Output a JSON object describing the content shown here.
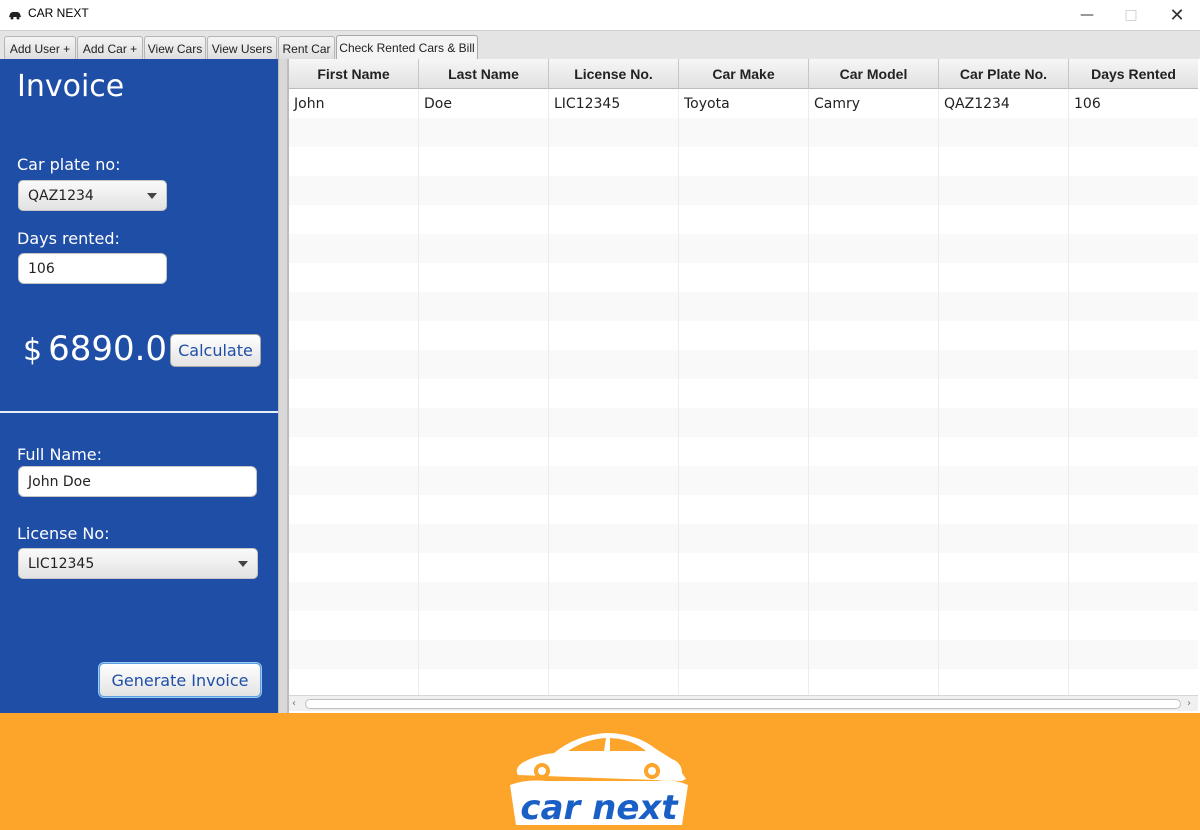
{
  "window": {
    "title": "CAR NEXT"
  },
  "tabs": [
    {
      "label": "Add User +"
    },
    {
      "label": "Add Car +"
    },
    {
      "label": "View Cars"
    },
    {
      "label": "View Users"
    },
    {
      "label": "Rent Car"
    },
    {
      "label": "Check Rented Cars & Bill",
      "active": true
    }
  ],
  "invoice": {
    "title": "Invoice",
    "car_plate_label": "Car plate no:",
    "car_plate_value": "QAZ1234",
    "days_rented_label": "Days rented:",
    "days_rented_value": "106",
    "currency": "$",
    "amount": "6890.0",
    "calculate_label": "Calculate",
    "full_name_label": "Full Name:",
    "full_name_value": "John Doe",
    "license_label": "License No:",
    "license_value": "LIC12345",
    "generate_label": "Generate Invoice"
  },
  "table": {
    "columns": [
      "First Name",
      "Last Name",
      "License No.",
      "Car Make",
      "Car Model",
      "Car Plate No.",
      "Days Rented"
    ],
    "rows": [
      [
        "John",
        "Doe",
        "LIC12345",
        "Toyota",
        "Camry",
        "QAZ1234",
        "106"
      ]
    ]
  },
  "footer": {
    "logo_text": "car next",
    "logo_icon": "car-icon"
  },
  "colors": {
    "panel_blue": "#1f4ea6",
    "footer_orange": "#fca52a",
    "logo_text_blue": "#1a5fc6"
  }
}
